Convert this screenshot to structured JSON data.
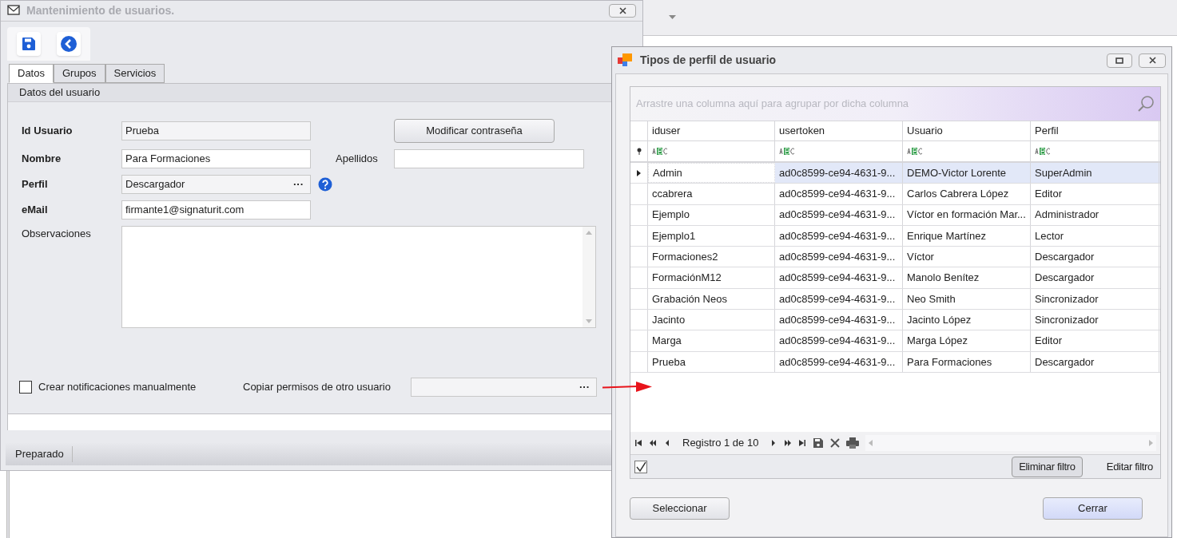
{
  "main_window": {
    "title": "Mantenimiento de usuarios.",
    "tabs": [
      {
        "label": "Datos",
        "selected": true
      },
      {
        "label": "Grupos",
        "selected": false
      },
      {
        "label": "Servicios",
        "selected": false
      }
    ],
    "section_title": "Datos del usuario",
    "id_usuario": {
      "label": "Id Usuario",
      "value": "Prueba"
    },
    "change_password_button": "Modificar contraseña",
    "nombre": {
      "label": "Nombre",
      "value": "Para Formaciones"
    },
    "apellidos": {
      "label": "Apellidos"
    },
    "perfil": {
      "label": "Perfil",
      "value": "Descargador",
      "browse": "···"
    },
    "email": {
      "label": "eMail",
      "value": "firmante1@signaturit.com"
    },
    "observaciones": {
      "label": "Observaciones"
    },
    "manual_notifications": {
      "label": "Crear notificaciones manualmente",
      "checked": false
    },
    "copy_permissions": {
      "label": "Copiar permisos de otro usuario",
      "browse": "···"
    },
    "status_bar": "Preparado"
  },
  "dialog": {
    "title": "Tipos de perfil de usuario",
    "group_hint": "Arrastre una columna aquí para agrupar por dicha columna",
    "columns": [
      "iduser",
      "usertoken",
      "Usuario",
      "Perfil"
    ],
    "rows": [
      {
        "cells": [
          "Admin",
          "ad0c8599-ce94-4631-9...",
          "DEMO-Victor Lorente",
          "SuperAdmin"
        ],
        "selected": true
      },
      {
        "cells": [
          "ccabrera",
          "ad0c8599-ce94-4631-9...",
          "Carlos Cabrera López",
          "Editor"
        ],
        "selected": false
      },
      {
        "cells": [
          "Ejemplo",
          "ad0c8599-ce94-4631-9...",
          "Víctor en formación Mar...",
          "Administrador"
        ],
        "selected": false
      },
      {
        "cells": [
          "Ejemplo1",
          "ad0c8599-ce94-4631-9...",
          "Enrique Martínez",
          "Lector"
        ],
        "selected": false
      },
      {
        "cells": [
          "Formaciones2",
          "ad0c8599-ce94-4631-9...",
          "Víctor",
          "Descargador"
        ],
        "selected": false
      },
      {
        "cells": [
          "FormaciónM12",
          "ad0c8599-ce94-4631-9...",
          "Manolo Benítez",
          "Descargador"
        ],
        "selected": false
      },
      {
        "cells": [
          "Grabación Neos",
          "ad0c8599-ce94-4631-9...",
          "Neo Smith",
          "Sincronizador"
        ],
        "selected": false
      },
      {
        "cells": [
          "Jacinto",
          "ad0c8599-ce94-4631-9...",
          "Jacinto López",
          "Sincronizador"
        ],
        "selected": false
      },
      {
        "cells": [
          "Marga",
          "ad0c8599-ce94-4631-9...",
          "Marga López",
          "Editor"
        ],
        "selected": false
      },
      {
        "cells": [
          "Prueba",
          "ad0c8599-ce94-4631-9...",
          "Para Formaciones",
          "Descargador"
        ],
        "selected": false
      }
    ],
    "navigator": "Registro 1 de 10",
    "filter_enabled": {
      "checked": true
    },
    "clear_filter_button": "Eliminar filtro",
    "edit_filter_link": "Editar filtro",
    "select_button": "Seleccionar",
    "close_button": "Cerrar"
  }
}
